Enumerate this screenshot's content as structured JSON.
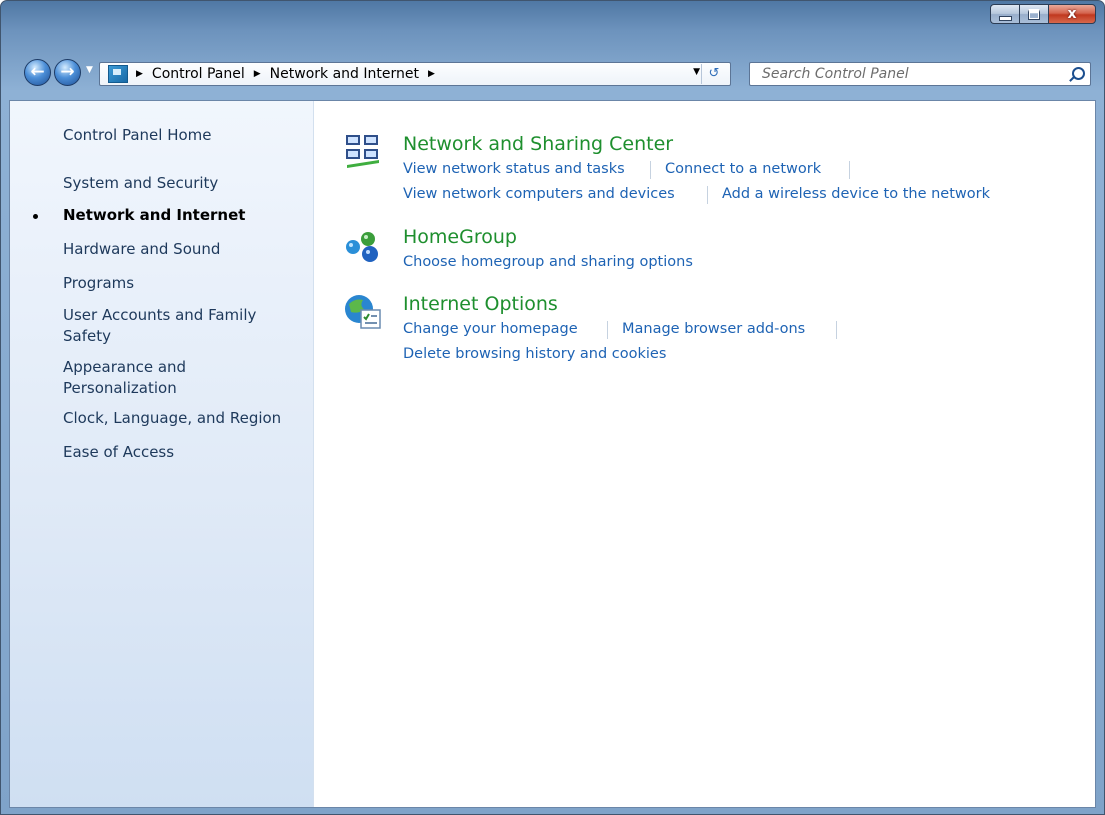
{
  "window": {
    "controls": {
      "minimize": "minimize",
      "maximize": "maximize",
      "close": "x"
    }
  },
  "navbar": {
    "breadcrumb": [
      "Control Panel",
      "Network and Internet"
    ],
    "search_placeholder": "Search Control Panel"
  },
  "sidebar": {
    "items": [
      {
        "label": "Control Panel Home",
        "active": false
      },
      {
        "label": "System and Security",
        "active": false
      },
      {
        "label": "Network and Internet",
        "active": true
      },
      {
        "label": "Hardware and Sound",
        "active": false
      },
      {
        "label": "Programs",
        "active": false
      },
      {
        "label": "User Accounts and Family Safety",
        "active": false
      },
      {
        "label": "Appearance and Personalization",
        "active": false
      },
      {
        "label": "Clock, Language, and Region",
        "active": false
      },
      {
        "label": "Ease of Access",
        "active": false
      }
    ]
  },
  "categories": [
    {
      "title": "Network and Sharing Center",
      "icon": "network-icon",
      "links": [
        "View network status and tasks",
        "Connect to a network",
        "View network computers and devices",
        "Add a wireless device to the network"
      ]
    },
    {
      "title": "HomeGroup",
      "icon": "homegroup-icon",
      "links": [
        "Choose homegroup and sharing options"
      ]
    },
    {
      "title": "Internet Options",
      "icon": "internet-options-icon",
      "links": [
        "Change your homepage",
        "Manage browser add-ons",
        "Delete browsing history and cookies"
      ]
    }
  ],
  "colors": {
    "category_title": "#1e8f2e",
    "link": "#1e63b4",
    "sidebar_text": "#1e395b"
  }
}
